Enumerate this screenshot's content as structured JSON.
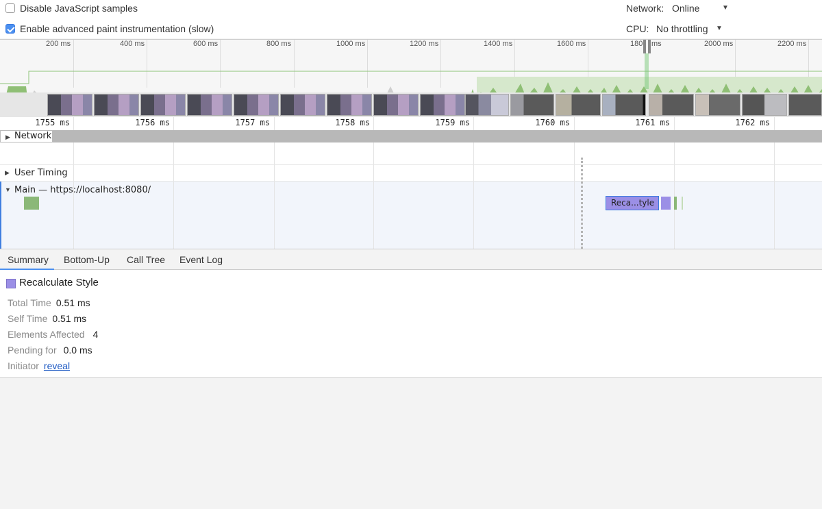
{
  "settings": {
    "disable_js_samples": {
      "label": "Disable JavaScript samples",
      "checked": false
    },
    "advanced_paint": {
      "label": "Enable advanced paint instrumentation (slow)",
      "checked": true
    },
    "network": {
      "label": "Network:",
      "value": "Online"
    },
    "cpu": {
      "label": "CPU:",
      "value": "No throttling"
    }
  },
  "overview": {
    "ticks": [
      "200 ms",
      "400 ms",
      "600 ms",
      "800 ms",
      "1000 ms",
      "1200 ms",
      "1400 ms",
      "1600 ms",
      "180",
      "ms",
      "2000 ms",
      "2200 ms"
    ]
  },
  "ruler": {
    "ticks": [
      "1755 ms",
      "1756 ms",
      "1757 ms",
      "1758 ms",
      "1759 ms",
      "1760 ms",
      "1761 ms",
      "1762 ms"
    ]
  },
  "tracks": {
    "network_label": "Network",
    "user_timing_label": "User Timing",
    "main_label": "Main — https://localhost:8080/",
    "recalc_block_label": "Reca...tyle"
  },
  "tabs": [
    "Summary",
    "Bottom-Up",
    "Call Tree",
    "Event Log"
  ],
  "summary": {
    "title": "Recalculate Style",
    "color": "#9b8fe6",
    "rows": [
      {
        "key": "Total Time",
        "value": "0.51 ms"
      },
      {
        "key": "Self Time",
        "value": "0.51 ms"
      },
      {
        "key": "Elements Affected",
        "value": "4"
      },
      {
        "key": "Pending for",
        "value": "0.0 ms"
      }
    ],
    "initiator_key": "Initiator",
    "initiator_link": "reveal"
  }
}
